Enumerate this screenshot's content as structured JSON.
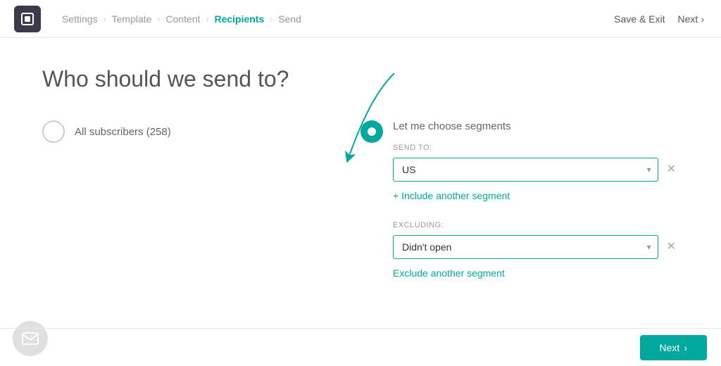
{
  "header": {
    "logo_alt": "App logo",
    "breadcrumbs": [
      {
        "id": "settings",
        "label": "Settings",
        "active": false
      },
      {
        "id": "template",
        "label": "Template",
        "active": false
      },
      {
        "id": "content",
        "label": "Content",
        "active": false
      },
      {
        "id": "recipients",
        "label": "Recipients",
        "active": true
      },
      {
        "id": "send",
        "label": "Send",
        "active": false
      }
    ],
    "save_exit_label": "Save & Exit",
    "next_label": "Next"
  },
  "main": {
    "page_title": "Who should we send to?",
    "option_all_label": "All subscribers (258)",
    "option_segments_label": "Let me choose segments",
    "send_to_label": "SEND TO:",
    "send_to_value": "US",
    "include_another_label": "+ Include another segment",
    "excluding_label": "EXCLUDING:",
    "excluding_value": "Didn't open",
    "exclude_another_label": "Exclude another segment"
  },
  "bottom": {
    "next_label": "Next"
  },
  "icons": {
    "chevron_down": "▾",
    "chevron_right": "›",
    "close": "✕",
    "arrow_next": "›"
  },
  "colors": {
    "teal": "#00a89d",
    "gray_text": "#999",
    "dark": "#3a3a4a"
  }
}
